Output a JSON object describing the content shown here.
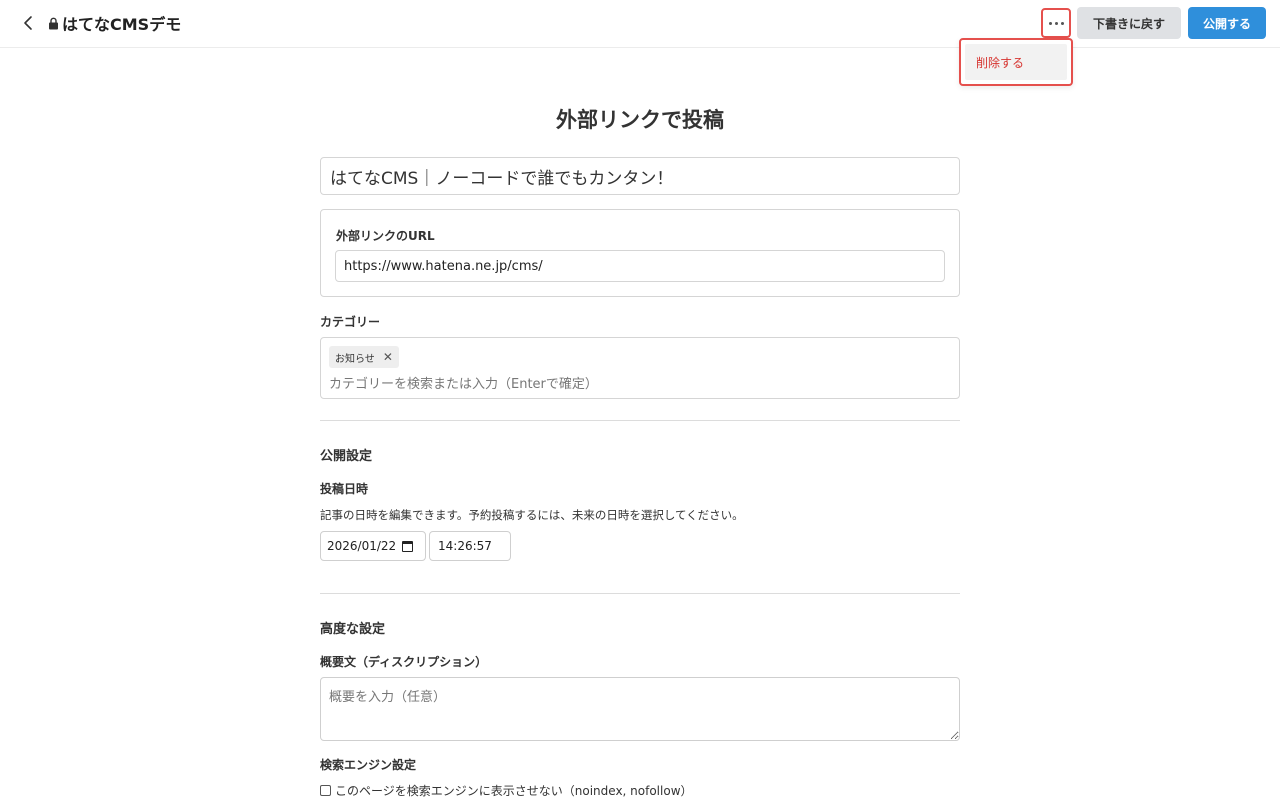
{
  "header": {
    "site_title": "はてなCMSデモ",
    "draft_button": "下書きに戻す",
    "publish_button": "公開する"
  },
  "dropdown": {
    "items": [
      "削除する"
    ]
  },
  "form": {
    "heading": "外部リンクで投稿",
    "title_value": "はてなCMS｜ノーコードで誰でもカンタン！",
    "url_label": "外部リンクのURL",
    "url_value": "https://www.hatena.ne.jp/cms/",
    "category_label": "カテゴリー",
    "category_tags": [
      "お知らせ"
    ],
    "category_placeholder": "カテゴリーを検索または入力（Enterで確定）"
  },
  "publish_settings": {
    "section_title": "公開設定",
    "datetime_label": "投稿日時",
    "helper_text": "記事の日時を編集できます。予約投稿するには、未来の日時を選択してください。",
    "date_value": "2026/01/22",
    "time_value": "14:26:57"
  },
  "advanced_settings": {
    "section_title": "高度な設定",
    "description_label": "概要文（ディスクリプション）",
    "description_placeholder": "概要を入力（任意）",
    "seo_label": "検索エンジン設定",
    "noindex_label": "このページを検索エンジンに表示させない（noindex, nofollow）"
  },
  "colors": {
    "accent": "#2f8fdb",
    "danger": "#d6332f",
    "highlight": "#e5504d"
  },
  "icons": [
    "chevron-left-icon",
    "lock-icon",
    "more-horizontal-icon",
    "close-icon",
    "calendar-icon"
  ]
}
